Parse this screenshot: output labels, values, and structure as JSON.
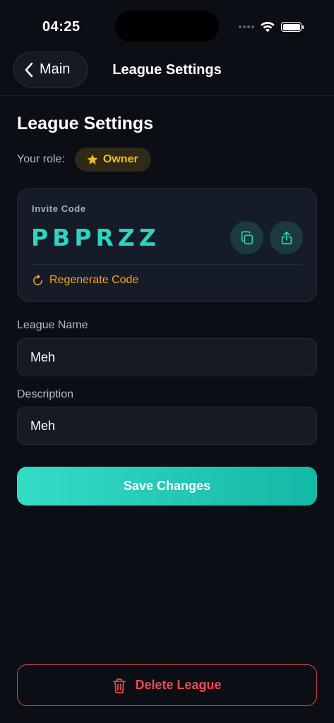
{
  "status_bar": {
    "time": "04:25"
  },
  "nav": {
    "back_label": "Main",
    "title": "League Settings"
  },
  "page": {
    "title": "League Settings"
  },
  "role": {
    "label": "Your role:",
    "value": "Owner"
  },
  "invite": {
    "label": "Invite Code",
    "code": "PBPRZZ",
    "regenerate_label": "Regenerate Code"
  },
  "fields": {
    "name": {
      "label": "League Name",
      "value": "Meh"
    },
    "description": {
      "label": "Description",
      "value": "Meh"
    }
  },
  "actions": {
    "save_label": "Save Changes",
    "delete_label": "Delete League"
  },
  "colors": {
    "background": "#0b0e14",
    "accent": "#2dd4bf",
    "owner_badge": "#f5b91f",
    "regenerate": "#f5a524",
    "danger": "#e0484c"
  },
  "icons": {
    "back": "chevron-left-icon",
    "role": "star-icon",
    "copy": "copy-icon",
    "share": "share-icon",
    "regenerate": "refresh-icon",
    "delete": "trash-icon"
  }
}
